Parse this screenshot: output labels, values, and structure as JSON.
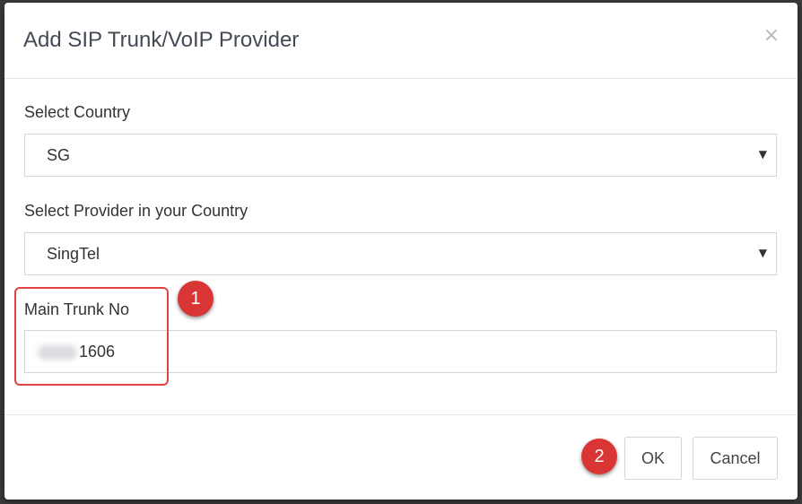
{
  "dialog": {
    "title": "Add SIP Trunk/VoIP Provider",
    "close_glyph": "×"
  },
  "country": {
    "label": "Select Country",
    "selected": "SG"
  },
  "provider": {
    "label": "Select Provider in your Country",
    "selected": "SingTel"
  },
  "main_trunk": {
    "label": "Main Trunk No",
    "visible_value": "1606"
  },
  "annotations": {
    "step1": "1",
    "step2": "2",
    "highlight_color": "#e04444",
    "badge_color": "#d93535"
  },
  "footer": {
    "ok_label": "OK",
    "cancel_label": "Cancel"
  },
  "icons": {
    "dropdown": "caret-down-icon",
    "close": "close-icon"
  }
}
